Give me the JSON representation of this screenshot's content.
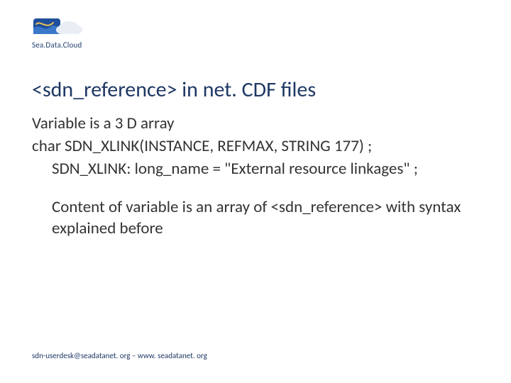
{
  "logo": {
    "brand_line1": "Sea.Data.Cloud"
  },
  "title": "<sdn_reference> in net. CDF files",
  "body": {
    "line1": "Variable is a 3 D array",
    "line2": "char SDN_XLINK(INSTANCE, REFMAX, STRING 177) ;",
    "line3": "SDN_XLINK: long_name = \"External resource linkages\" ;",
    "line4": "Content of variable is an array of <sdn_reference> with syntax explained before"
  },
  "footer": "sdn-userdesk@seadatanet. org – www. seadatanet. org"
}
